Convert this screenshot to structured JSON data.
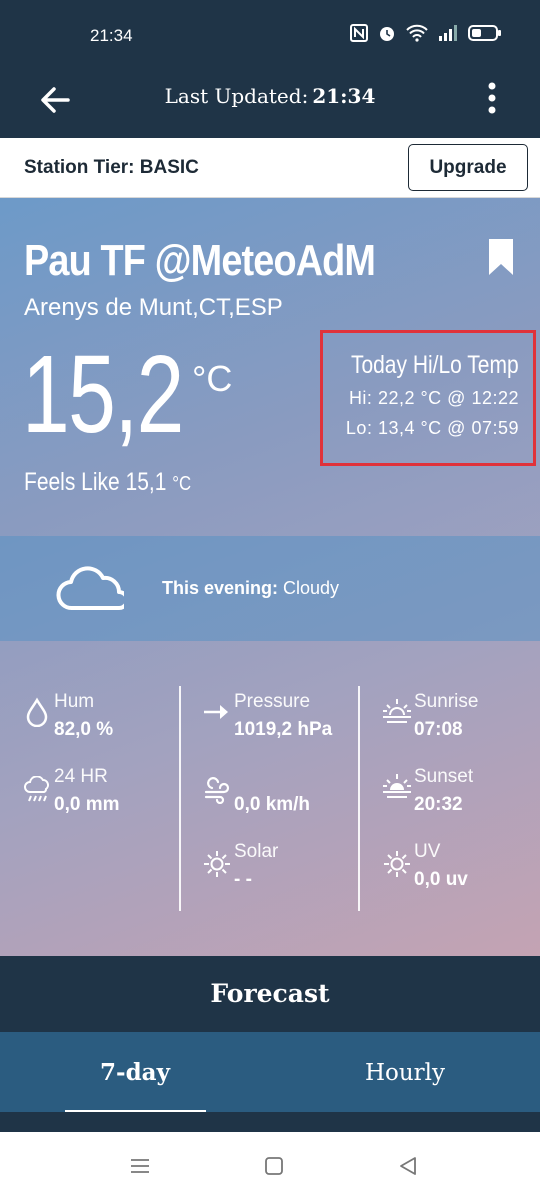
{
  "status_bar": {
    "time": "21:34"
  },
  "app_bar": {
    "last_updated_label": "Last Updated:",
    "last_updated_time": "21:34"
  },
  "tier": {
    "label": "Station Tier: BASIC",
    "upgrade_label": "Upgrade"
  },
  "station": {
    "name": "Pau TF @MeteoAdM",
    "location": "Arenys de Munt,CT,ESP"
  },
  "current": {
    "temp": "15,2",
    "unit": "°C",
    "feels_label": "Feels Like 15,1",
    "feels_unit": "°C"
  },
  "hilo": {
    "title": "Today Hi/Lo Temp",
    "hi": "Hi: 22,2 °C @ 12:22",
    "lo": "Lo: 13,4 °C @ 07:59",
    "highlight_color": "#e0323a"
  },
  "forecast_strip": {
    "period": "This evening:",
    "condition": "Cloudy"
  },
  "stats": {
    "hum": {
      "label": "Hum",
      "value": "82,0 %"
    },
    "rain24": {
      "label": "24 HR",
      "value": "0,0 mm"
    },
    "pressure": {
      "label": "Pressure",
      "value": "1019,2 hPa"
    },
    "wind": {
      "value": "0,0 km/h"
    },
    "solar": {
      "label": "Solar",
      "value": "- -"
    },
    "sunrise": {
      "label": "Sunrise",
      "value": "07:08"
    },
    "sunset": {
      "label": "Sunset",
      "value": "20:32"
    },
    "uv": {
      "label": "UV",
      "value": "0,0 uv"
    }
  },
  "forecast": {
    "header": "Forecast",
    "tabs": [
      {
        "label": "7-day"
      },
      {
        "label": "Hourly"
      }
    ]
  },
  "colors": {
    "primary_dark": "#1f3447",
    "tab_bar": "#2b5c80"
  },
  "icons": [
    "back-arrow-icon",
    "kebab-menu-icon",
    "bookmark-icon",
    "cloud-icon",
    "droplet-icon",
    "rain-cloud-icon",
    "arrow-right-icon",
    "wind-icon",
    "sun-icon",
    "sunrise-icon",
    "sunset-icon",
    "uv-icon"
  ]
}
